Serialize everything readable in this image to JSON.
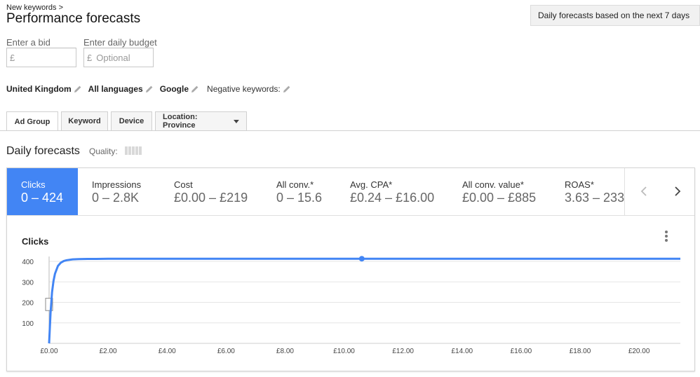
{
  "header": {
    "breadcrumb": "New keywords >",
    "title": "Performance forecasts",
    "forecast_range": "Daily forecasts based on the next 7 days"
  },
  "inputs": {
    "bid": {
      "label": "Enter a bid",
      "currency": "£",
      "placeholder": ""
    },
    "budget": {
      "label": "Enter daily budget",
      "currency": "£",
      "placeholder": "Optional"
    }
  },
  "targeting": {
    "location": "United Kingdom",
    "language": "All languages",
    "network": "Google",
    "negative_label": "Negative keywords:"
  },
  "tabs": [
    {
      "label": "Ad Group",
      "active": true
    },
    {
      "label": "Keyword",
      "active": false
    },
    {
      "label": "Device",
      "active": false
    },
    {
      "label": "Location: Province",
      "active": false,
      "dropdown": true
    }
  ],
  "section": {
    "title": "Daily forecasts",
    "quality_label": "Quality:"
  },
  "metrics": [
    {
      "label": "Clicks",
      "value": "0 – 424",
      "active": true
    },
    {
      "label": "Impressions",
      "value": "0 – 2.8K",
      "active": false
    },
    {
      "label": "Cost",
      "value": "£0.00 – £219",
      "active": false
    },
    {
      "label": "All conv.*",
      "value": "0 – 15.6",
      "active": false
    },
    {
      "label": "Avg. CPA*",
      "value": "£0.24 – £16.00",
      "active": false
    },
    {
      "label": "All conv. value*",
      "value": "£0.00 – £885",
      "active": false
    },
    {
      "label": "ROAS*",
      "value": "3.63 – 233",
      "active": false
    }
  ],
  "icons": {
    "pencil": "pencil-icon",
    "dropdown": "caret-down-icon",
    "prev": "chevron-left-icon",
    "next": "chevron-right-icon",
    "menu": "more-vert-icon"
  },
  "colors": {
    "accent": "#4285f4",
    "series": "#4285f4",
    "grid": "#e6e6e6"
  },
  "chart_data": {
    "type": "line",
    "title": "Clicks",
    "xlabel": "",
    "ylabel": "",
    "x_ticks": [
      0,
      2,
      4,
      6,
      8,
      10,
      12,
      14,
      16,
      18,
      20
    ],
    "x_tick_labels": [
      "£0.00",
      "£2.00",
      "£4.00",
      "£6.00",
      "£8.00",
      "£10.00",
      "£12.00",
      "£14.00",
      "£16.00",
      "£18.00",
      "£20.00"
    ],
    "y_ticks": [
      100,
      200,
      300,
      400
    ],
    "xlim": [
      0,
      21.4
    ],
    "ylim": [
      0,
      424
    ],
    "grid": true,
    "series": [
      {
        "x": [
          0,
          0.05,
          0.1,
          0.15,
          0.2,
          0.3,
          0.4,
          0.5,
          0.6,
          0.8,
          1.0,
          1.3,
          1.6,
          2.0,
          3.0,
          5.0,
          8.0,
          10.6,
          14.0,
          18.0,
          21.4
        ],
        "y": [
          0,
          150,
          250,
          305,
          340,
          378,
          394,
          402,
          406,
          410,
          411,
          412,
          412,
          413,
          413,
          413,
          413,
          413,
          413,
          413,
          413
        ]
      }
    ],
    "marker": {
      "x": 10.6,
      "y": 413
    },
    "bid_marker": {
      "x": 0.0,
      "y_low": 160,
      "y_high": 220
    }
  }
}
